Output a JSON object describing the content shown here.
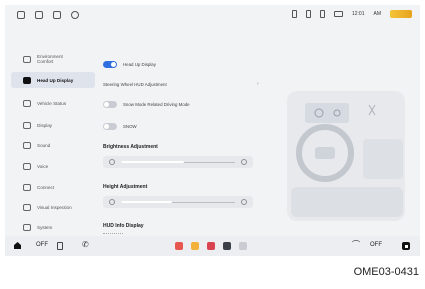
{
  "status_bar": {
    "left_icons": [
      "settings-icon",
      "phone-icon",
      "media-icon",
      "clock-icon"
    ],
    "right_icons": [
      "mic-icon",
      "signal-icon",
      "bluetooth-icon",
      "battery-icon"
    ],
    "time": "12:01",
    "am_pm": "AM"
  },
  "sidebar": {
    "items": [
      {
        "label": "Environment Comfort",
        "icon": "leaf-icon",
        "active": false
      },
      {
        "label": "Head Up Display",
        "icon": "hud-icon",
        "active": true
      },
      {
        "label": "Vehicle Status",
        "icon": "car-icon",
        "active": false
      },
      {
        "label": "Display",
        "icon": "display-icon",
        "active": false
      },
      {
        "label": "Sound",
        "icon": "speaker-icon",
        "active": false
      },
      {
        "label": "Voice",
        "icon": "voice-icon",
        "active": false
      },
      {
        "label": "Connect",
        "icon": "link-icon",
        "active": false
      },
      {
        "label": "Visual Inspection",
        "icon": "eye-icon",
        "active": false
      },
      {
        "label": "System",
        "icon": "gear-icon",
        "active": false
      }
    ]
  },
  "settings": {
    "hud_toggle_label": "Head Up Display",
    "hud_toggle_on": true,
    "steering_wheel_label": "Steering Wheel HUD Adjustment",
    "snow_mode_label": "Snow Mode Related Driving Mode",
    "snow_mode_on": false,
    "snow_label": "SNOW",
    "snow_on": false,
    "brightness_title": "Brightness Adjustment",
    "brightness_level": 0.55,
    "height_title": "Height Adjustment",
    "height_level": 0.45,
    "hud_info_title": "HUD Info Display"
  },
  "dock": {
    "left_off": "OFF",
    "right_off": "OFF",
    "apps": [
      {
        "name": "media-app-icon",
        "color": "#e8574f"
      },
      {
        "name": "navigation-app-icon",
        "color": "#f2b23a"
      },
      {
        "name": "radio-app-icon",
        "color": "#d9434f"
      },
      {
        "name": "phone-app-icon",
        "color": "#3b3f47"
      },
      {
        "name": "apps-grid-icon",
        "color": "#c9ccd2"
      }
    ]
  },
  "caption": "OME03-0431"
}
